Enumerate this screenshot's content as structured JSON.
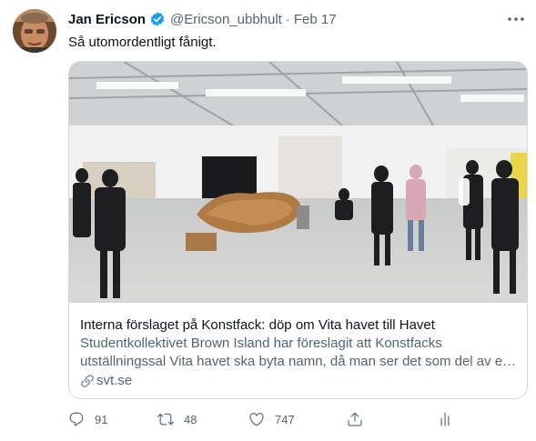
{
  "tweet": {
    "author_name": "Jan Ericson",
    "author_handle": "@Ericson_ubbhult",
    "separator": "·",
    "date": "Feb 17",
    "text": "Så utomordentligt fånigt.",
    "verified": true
  },
  "card": {
    "title": "Interna förslaget på Konstfack: döp om Vita havet till Havet",
    "description_line1": "Studentkollektivet Brown Island har föreslagit att Konstfacks",
    "description_line2": "utställningssal Vita havet ska byta namn, då man ser det som del av en…",
    "domain": "svt.se",
    "link_icon": "link-icon"
  },
  "actions": {
    "reply_count": "91",
    "retweet_count": "48",
    "like_count": "747"
  },
  "colors": {
    "text_primary": "#0f1419",
    "text_secondary": "#536471",
    "verified_blue": "#1d9bf0",
    "border": "#cfd9de"
  },
  "icons": [
    "more-icon",
    "verified-icon",
    "reply-icon",
    "retweet-icon",
    "like-icon",
    "share-icon",
    "analytics-icon",
    "link-icon"
  ]
}
